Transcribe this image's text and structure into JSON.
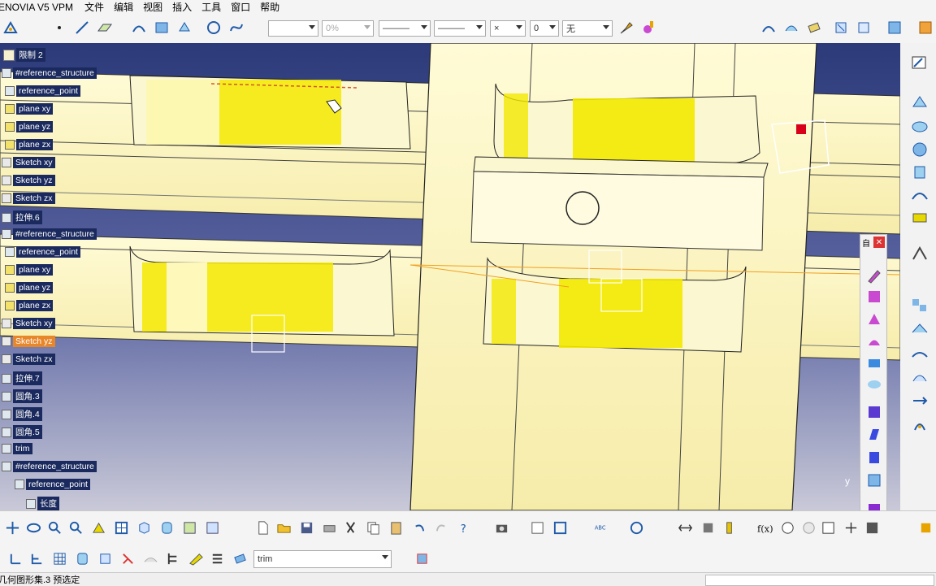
{
  "menubar": {
    "app_title": "ENOVIA V5 VPM",
    "items": [
      "文件",
      "编辑",
      "视图",
      "插入",
      "工具",
      "窗口",
      "帮助"
    ]
  },
  "toolbar": {
    "linetype_combo": "",
    "transparency_combo": "0%",
    "linestyle_combo": "———",
    "lineweight_combo": "———",
    "point_combo": "×",
    "layer_combo": "0",
    "filter_combo": "无",
    "search_value": "trim"
  },
  "tree": {
    "root": "限制 2",
    "nodes": [
      {
        "label": "#reference_structure",
        "icon": "ref-structure-icon"
      },
      {
        "label": "reference_point",
        "icon": "point-icon"
      },
      {
        "label": "plane xy",
        "icon": "plane-icon"
      },
      {
        "label": "plane yz",
        "icon": "plane-icon"
      },
      {
        "label": "plane zx",
        "icon": "plane-icon"
      },
      {
        "label": "Sketch xy",
        "icon": "sketch-icon"
      },
      {
        "label": "Sketch yz",
        "icon": "sketch-icon"
      },
      {
        "label": "Sketch zx",
        "icon": "sketch-icon"
      },
      {
        "label": "拉伸.6",
        "icon": "extrude-icon"
      },
      {
        "label": "#reference_structure",
        "icon": "ref-structure-icon"
      },
      {
        "label": "reference_point",
        "icon": "point-icon"
      },
      {
        "label": "plane xy",
        "icon": "plane-icon"
      },
      {
        "label": "plane yz",
        "icon": "plane-icon"
      },
      {
        "label": "plane zx",
        "icon": "plane-icon"
      },
      {
        "label": "Sketch xy",
        "icon": "sketch-icon"
      },
      {
        "label": "Sketch yz",
        "icon": "sketch-icon",
        "selected": true
      },
      {
        "label": "Sketch zx",
        "icon": "sketch-icon"
      },
      {
        "label": "拉伸.7",
        "icon": "extrude-icon"
      },
      {
        "label": "圆角.3",
        "icon": "fillet-icon"
      },
      {
        "label": "圆角.4",
        "icon": "fillet-icon"
      },
      {
        "label": "圆角.5",
        "icon": "fillet-icon"
      },
      {
        "label": "trim",
        "icon": "trim-icon"
      },
      {
        "label": "#reference_structure",
        "icon": "ref-structure-icon"
      },
      {
        "label": "reference_point",
        "icon": "point-icon"
      },
      {
        "label": "长度",
        "icon": "parameter-icon"
      }
    ]
  },
  "floatbar": {
    "title": "自"
  },
  "axis": {
    "y_label": "y"
  },
  "status": {
    "text": "几何图形集.3 预选定"
  },
  "colors": {
    "viewport_top": "#2c3a7a",
    "viewport_bottom": "#c9c9d8",
    "part_face": "#fbf7c0",
    "part_highlight": "#f3e900",
    "tree_label_bg": "#1b2a5e",
    "tree_selected_bg": "#e8862a"
  }
}
